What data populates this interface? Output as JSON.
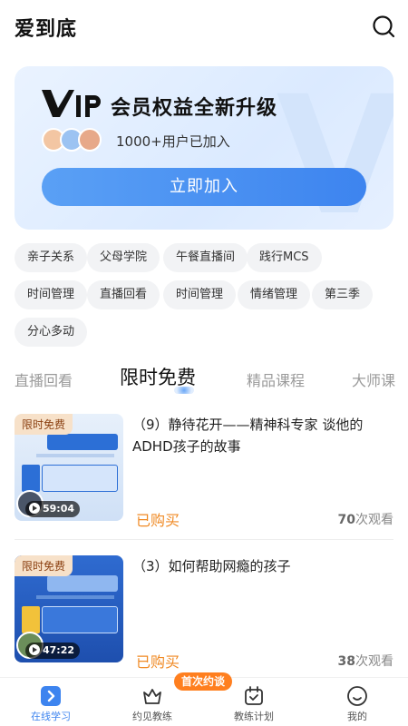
{
  "header": {
    "title": "爱到底"
  },
  "vip": {
    "logo_text": "VIP",
    "title": "会员权益全新升级",
    "joined": "1000+用户已加入",
    "join_button": "立即加入"
  },
  "tags": [
    "亲子关系",
    "父母学院",
    "午餐直播间",
    "践行MCS",
    "时间管理",
    "直播回看",
    "时间管理",
    "情绪管理",
    "第三季",
    "分心多动"
  ],
  "tabs": [
    {
      "label": "直播回看",
      "active": false
    },
    {
      "label": "限时免费",
      "active": true
    },
    {
      "label": "精品课程",
      "active": false
    },
    {
      "label": "大师课",
      "active": false
    }
  ],
  "courses": [
    {
      "badge": "限时免费",
      "duration": "59:04",
      "title": "（9）静待花开——精神科专家 谈他的ADHD孩子的故事",
      "status": "已购买",
      "views_count": "70",
      "views_suffix": "次观看"
    },
    {
      "badge": "限时免费",
      "duration": "47:22",
      "title": "（3）如何帮助网瘾的孩子",
      "status": "已购买",
      "views_count": "38",
      "views_suffix": "次观看"
    }
  ],
  "bottom_nav": {
    "items": [
      {
        "label": "在线学习",
        "icon": "play-square-icon",
        "active": true
      },
      {
        "label": "约见教练",
        "icon": "crown-icon",
        "active": false
      },
      {
        "label": "教练计划",
        "icon": "calendar-check-icon",
        "active": false
      },
      {
        "label": "我的",
        "icon": "smile-icon",
        "active": false
      }
    ],
    "badge": "首次约谈"
  },
  "colors": {
    "accent": "#3d84ef",
    "orange": "#f08a24",
    "badge": "#ff7f1f"
  }
}
